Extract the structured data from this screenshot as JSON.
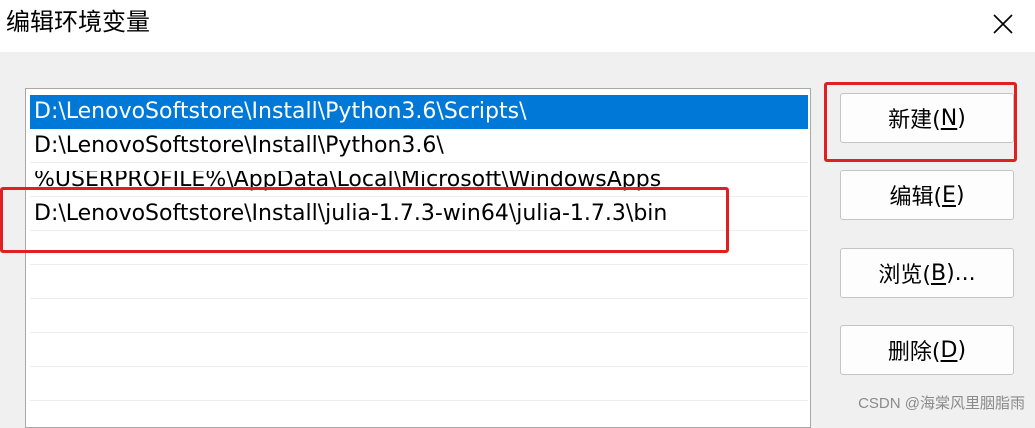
{
  "window": {
    "title": "编辑环境变量",
    "close_glyph": "✕"
  },
  "path_list": {
    "items": [
      {
        "text": "D:\\LenovoSoftstore\\Install\\Python3.6\\Scripts\\",
        "selected": true
      },
      {
        "text": "D:\\LenovoSoftstore\\Install\\Python3.6\\",
        "selected": false
      },
      {
        "text": "%USERPROFILE%\\AppData\\Local\\Microsoft\\WindowsApps",
        "selected": false
      },
      {
        "text": "D:\\LenovoSoftstore\\Install\\julia-1.7.3-win64\\julia-1.7.3\\bin",
        "selected": false
      }
    ]
  },
  "buttons": {
    "new": {
      "label": "新建(",
      "key": "N",
      "suffix": ")"
    },
    "edit": {
      "label": "编辑(",
      "key": "E",
      "suffix": ")"
    },
    "browse": {
      "label": "浏览(",
      "key": "B",
      "suffix": ")..."
    },
    "delete": {
      "label": "删除(",
      "key": "D",
      "suffix": ")"
    }
  },
  "colors": {
    "selection": "#0078d7",
    "annotation": "#e02020"
  },
  "watermark": "CSDN @海棠风里胭脂雨"
}
